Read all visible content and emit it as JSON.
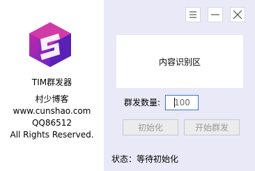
{
  "app": {
    "name": "TIM群发器",
    "author": "村少博客",
    "website": "www.cunshao.com",
    "qq": "QQ86512",
    "rights": "All Rights Reserved."
  },
  "window_controls": [
    {
      "icon": "menu-icon"
    },
    {
      "icon": "minimize-icon"
    },
    {
      "icon": "close-icon"
    }
  ],
  "recognition": {
    "label": "内容识别区"
  },
  "group_send": {
    "count_label": "群发数量:",
    "count_value": "100"
  },
  "buttons": {
    "init_label": "初始化",
    "start_label": "开始群发"
  },
  "status": {
    "text": "状态：等待初始化"
  },
  "colors": {
    "panel_bg": "#e9e9f7",
    "logo_primary": "#8a2be2",
    "logo_secondary": "#c02aa6",
    "input_border": "#3a74c7"
  }
}
